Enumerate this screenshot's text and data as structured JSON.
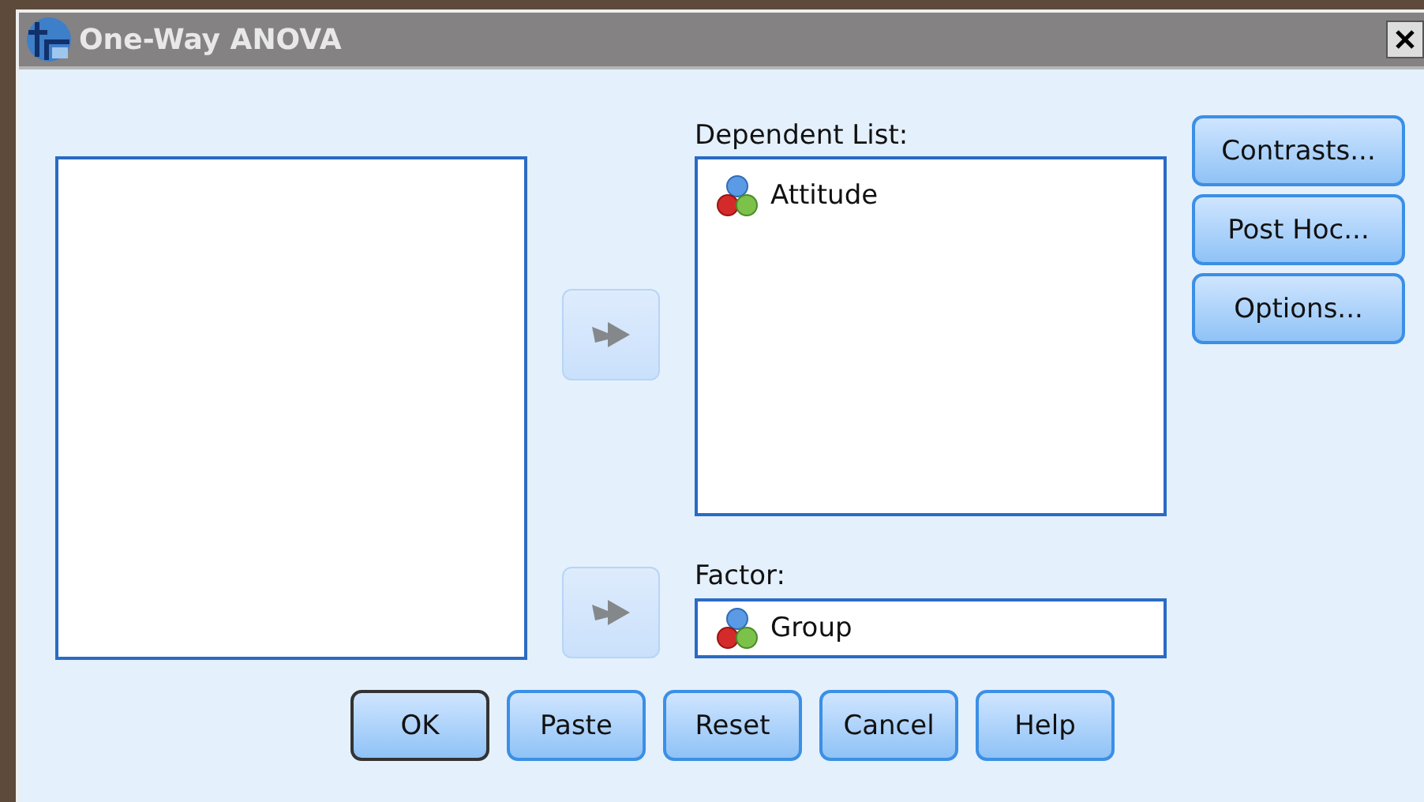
{
  "window": {
    "title": "One-Way ANOVA"
  },
  "move_buttons": [
    {
      "disabled": true
    },
    {
      "disabled": true
    }
  ],
  "dependent_list": {
    "label": "Dependent List:",
    "items": [
      {
        "name": "Attitude"
      }
    ]
  },
  "factor": {
    "label": "Factor:",
    "value": "Group"
  },
  "side_buttons": [
    {
      "label": "Contrasts..."
    },
    {
      "label": "Post Hoc..."
    },
    {
      "label": "Options..."
    }
  ],
  "buttons": [
    {
      "label": "OK",
      "default": true
    },
    {
      "label": "Paste",
      "default": false
    },
    {
      "label": "Reset",
      "default": false
    },
    {
      "label": "Cancel",
      "default": false
    },
    {
      "label": "Help",
      "default": false
    }
  ]
}
